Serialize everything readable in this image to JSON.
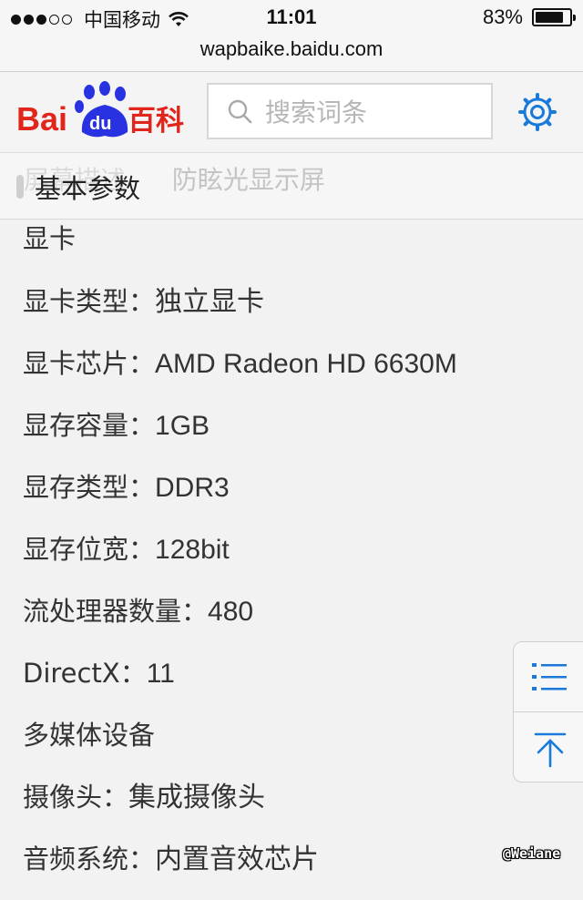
{
  "status_bar": {
    "signal_full_dots": 3,
    "signal_empty_dots": 2,
    "carrier": "中国移动",
    "time": "11:01",
    "battery_percent_text": "83%",
    "battery_level": 0.83
  },
  "url_bar": {
    "url": "wapbaike.baidu.com"
  },
  "header": {
    "logo_text_left": "Bai",
    "logo_text_paw": "du",
    "logo_text_right": "百科",
    "search_placeholder": "搜索词条",
    "settings_icon": "gear-icon"
  },
  "section": {
    "title": "基本参数",
    "ghost_text": [
      "屏幕描述",
      "防眩光显示屏"
    ]
  },
  "rows": [
    {
      "key": "显卡",
      "val": ""
    },
    {
      "key": "显卡类型：",
      "val": "独立显卡"
    },
    {
      "key": "显卡芯片：",
      "val": "AMD Radeon HD 6630M"
    },
    {
      "key": "显存容量：",
      "val": "1GB"
    },
    {
      "key": "显存类型：",
      "val": "DDR3"
    },
    {
      "key": "显存位宽：",
      "val": "128bit"
    },
    {
      "key": "流处理器数量：",
      "val": "480"
    },
    {
      "key": "DirectX：",
      "val": "11"
    },
    {
      "key": "多媒体设备",
      "val": ""
    },
    {
      "key": "摄像头：",
      "val": "集成摄像头"
    },
    {
      "key": "音频系统：",
      "val": "内置音效芯片"
    }
  ],
  "floating_tools": {
    "toc_icon": "list-icon",
    "top_icon": "back-to-top-icon"
  },
  "watermark": "@Weiane",
  "colors": {
    "accent": "#1a7ad9",
    "logo_red": "#e1251b",
    "logo_blue": "#2932e1"
  }
}
